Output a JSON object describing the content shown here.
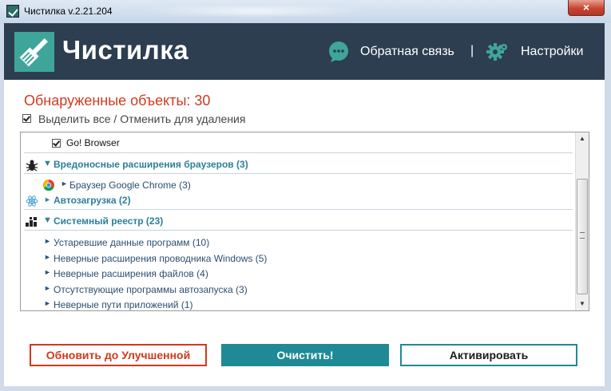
{
  "titlebar": {
    "title": "Чистилка v.2.21.204",
    "close_label": "×"
  },
  "header": {
    "logo_text": "Чистилка",
    "feedback_label": "Обратная связь",
    "separator": "|",
    "settings_label": "Настройки"
  },
  "summary": {
    "found_label": "Обнаруженные объекты: 30",
    "select_all_label": "Выделить все / Отменить для удаления",
    "select_all_checked": true
  },
  "list": {
    "top_item": {
      "label": "Go! Browser",
      "checked": true
    },
    "categories": [
      {
        "label": "Вредоносные расширения браузеров (3)",
        "expanded": true,
        "icon": "bug-icon",
        "children": [
          {
            "label": "Браузер Google Chrome (3)",
            "icon": "chrome-icon"
          }
        ]
      },
      {
        "label": "Автозагрузка (2)",
        "expanded": false,
        "icon": "atom-icon",
        "children": []
      },
      {
        "label": "Системный реестр (23)",
        "expanded": true,
        "icon": "registry-icon",
        "children": [
          {
            "label": "Устаревшие данные программ (10)"
          },
          {
            "label": "Неверные расширения проводника Windows (5)"
          },
          {
            "label": "Неверные расширения файлов (4)"
          },
          {
            "label": "Отсутствующие программы автозапуска (3)"
          },
          {
            "label": "Неверные пути приложений (1)"
          }
        ]
      }
    ]
  },
  "buttons": {
    "upgrade": "Обновить до Улучшенной",
    "clean": "Очистить!",
    "activate": "Активировать"
  },
  "colors": {
    "header_bg": "#2c3e50",
    "accent_teal": "#1f8a96",
    "logo_teal": "#3fa59a",
    "alert_red": "#d0391d"
  }
}
